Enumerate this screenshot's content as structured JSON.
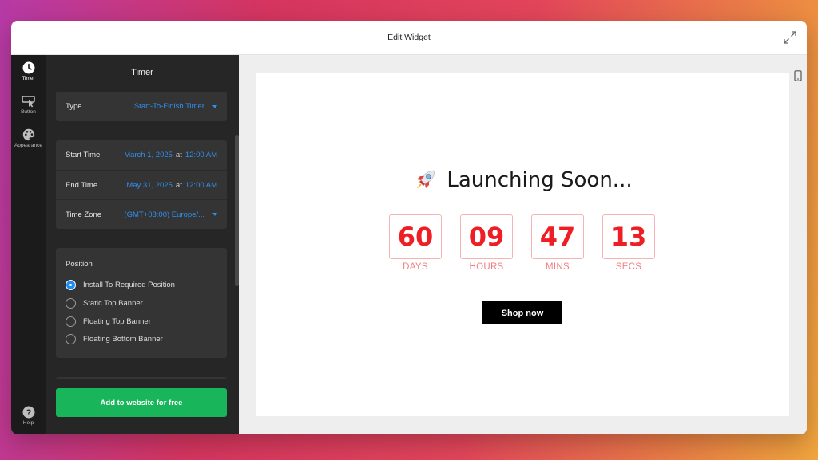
{
  "window": {
    "title": "Edit Widget"
  },
  "rail": {
    "items": [
      {
        "label": "Timer",
        "icon": "clock-icon"
      },
      {
        "label": "Button",
        "icon": "cursor-icon"
      },
      {
        "label": "Appearance",
        "icon": "palette-icon"
      }
    ],
    "help": {
      "label": "Help",
      "icon": "help-icon"
    }
  },
  "panel": {
    "title": "Timer",
    "type": {
      "label": "Type",
      "value": "Start-To-Finish Timer"
    },
    "start": {
      "label": "Start Time",
      "date": "March 1, 2025",
      "at": "at",
      "time": "12:00 AM"
    },
    "end": {
      "label": "End Time",
      "date": "May 31, 2025",
      "at": "at",
      "time": "12:00 AM"
    },
    "timezone": {
      "label": "Time Zone",
      "value": "(GMT+03:00) Europe/..."
    },
    "position": {
      "title": "Position",
      "options": [
        {
          "label": "Install To Required Position",
          "checked": true
        },
        {
          "label": "Static Top Banner",
          "checked": false
        },
        {
          "label": "Floating Top Banner",
          "checked": false
        },
        {
          "label": "Floating Bottom Banner",
          "checked": false
        }
      ]
    },
    "cta": "Add to website for free"
  },
  "preview": {
    "headline": "Launching Soon...",
    "units": [
      {
        "value": "60",
        "label": "DAYS"
      },
      {
        "value": "09",
        "label": "HOURS"
      },
      {
        "value": "47",
        "label": "MINS"
      },
      {
        "value": "13",
        "label": "SECS"
      }
    ],
    "button": "Shop now"
  },
  "colors": {
    "accent_blue": "#2f8ff0",
    "cta_green": "#18b55a",
    "timer_red": "#ef1d24",
    "timer_label": "#f07f83"
  }
}
